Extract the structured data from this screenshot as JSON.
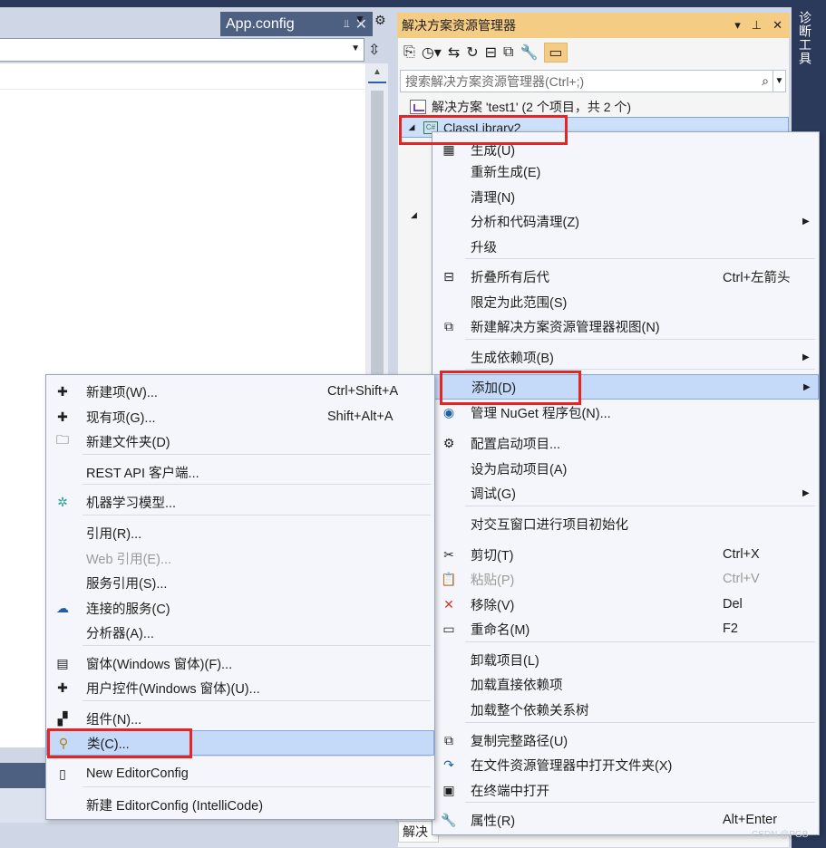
{
  "editor": {
    "tab_label": "App.config",
    "tab_pin_icon": "pin-icon",
    "tab_close_icon": "close-icon",
    "overflow_icon": "chevron-down-icon",
    "settings_icon": "gear-icon"
  },
  "diagnostics": {
    "label": "诊断工具"
  },
  "solution_explorer": {
    "title": "解决方案资源管理器",
    "title_buttons": [
      "▾",
      "⊥",
      "✕"
    ],
    "search_placeholder": "搜索解决方案资源管理器(Ctrl+;)",
    "solution_label": "解决方案 'test1' (2 个项目，共 2 个)",
    "project_label": "ClassLibrary2",
    "bottom_tab": "解决"
  },
  "context_menu": {
    "items": [
      {
        "label": "生成(U)",
        "icon": "build-icon",
        "shortcut": "",
        "submenu": false
      },
      {
        "label": "重新生成(E)",
        "icon": "",
        "shortcut": "",
        "submenu": false
      },
      {
        "label": "清理(N)",
        "icon": "",
        "shortcut": "",
        "submenu": false
      },
      {
        "label": "分析和代码清理(Z)",
        "icon": "",
        "shortcut": "",
        "submenu": true
      },
      {
        "label": "升级",
        "icon": "",
        "shortcut": "",
        "submenu": false
      },
      {
        "label": "折叠所有后代",
        "icon": "collapse-icon",
        "shortcut": "Ctrl+左箭头",
        "submenu": false
      },
      {
        "label": "限定为此范围(S)",
        "icon": "",
        "shortcut": "",
        "submenu": false
      },
      {
        "label": "新建解决方案资源管理器视图(N)",
        "icon": "new-view-icon",
        "shortcut": "",
        "submenu": false
      },
      {
        "label": "生成依赖项(B)",
        "icon": "",
        "shortcut": "",
        "submenu": true
      },
      {
        "label": "添加(D)",
        "icon": "",
        "shortcut": "",
        "submenu": true
      },
      {
        "label": "管理 NuGet 程序包(N)...",
        "icon": "nuget-icon",
        "shortcut": "",
        "submenu": false
      },
      {
        "label": "配置启动项目...",
        "icon": "gear-icon",
        "shortcut": "",
        "submenu": false
      },
      {
        "label": "设为启动项目(A)",
        "icon": "",
        "shortcut": "",
        "submenu": false
      },
      {
        "label": "调试(G)",
        "icon": "",
        "shortcut": "",
        "submenu": true
      },
      {
        "label": "对交互窗口进行项目初始化",
        "icon": "",
        "shortcut": "",
        "submenu": false
      },
      {
        "label": "剪切(T)",
        "icon": "scissors-icon",
        "shortcut": "Ctrl+X",
        "submenu": false
      },
      {
        "label": "粘贴(P)",
        "icon": "paste-icon",
        "shortcut": "Ctrl+V",
        "submenu": false
      },
      {
        "label": "移除(V)",
        "icon": "remove-icon",
        "shortcut": "Del",
        "submenu": false
      },
      {
        "label": "重命名(M)",
        "icon": "rename-icon",
        "shortcut": "F2",
        "submenu": false
      },
      {
        "label": "卸载项目(L)",
        "icon": "",
        "shortcut": "",
        "submenu": false
      },
      {
        "label": "加载直接依赖项",
        "icon": "",
        "shortcut": "",
        "submenu": false
      },
      {
        "label": "加载整个依赖关系树",
        "icon": "",
        "shortcut": "",
        "submenu": false
      },
      {
        "label": "复制完整路径(U)",
        "icon": "copy-icon",
        "shortcut": "",
        "submenu": false
      },
      {
        "label": "在文件资源管理器中打开文件夹(X)",
        "icon": "open-folder-icon",
        "shortcut": "",
        "submenu": false
      },
      {
        "label": "在终端中打开",
        "icon": "terminal-icon",
        "shortcut": "",
        "submenu": false
      },
      {
        "label": "属性(R)",
        "icon": "wrench-icon",
        "shortcut": "Alt+Enter",
        "submenu": false
      }
    ]
  },
  "add_submenu": {
    "items": [
      {
        "label": "新建项(W)...",
        "icon": "new-item-icon",
        "shortcut": "Ctrl+Shift+A"
      },
      {
        "label": "现有项(G)...",
        "icon": "existing-item-icon",
        "shortcut": "Shift+Alt+A"
      },
      {
        "label": "新建文件夹(D)",
        "icon": "new-folder-icon",
        "shortcut": ""
      },
      {
        "label": "REST API 客户端...",
        "icon": "",
        "shortcut": ""
      },
      {
        "label": "机器学习模型...",
        "icon": "ml-model-icon",
        "shortcut": ""
      },
      {
        "label": "引用(R)...",
        "icon": "",
        "shortcut": ""
      },
      {
        "label": "Web 引用(E)...",
        "icon": "",
        "shortcut": ""
      },
      {
        "label": "服务引用(S)...",
        "icon": "",
        "shortcut": ""
      },
      {
        "label": "连接的服务(C)",
        "icon": "connected-service-icon",
        "shortcut": ""
      },
      {
        "label": "分析器(A)...",
        "icon": "",
        "shortcut": ""
      },
      {
        "label": "窗体(Windows 窗体)(F)...",
        "icon": "form-icon",
        "shortcut": ""
      },
      {
        "label": "用户控件(Windows 窗体)(U)...",
        "icon": "user-control-icon",
        "shortcut": ""
      },
      {
        "label": "组件(N)...",
        "icon": "component-icon",
        "shortcut": ""
      },
      {
        "label": "类(C)...",
        "icon": "class-icon",
        "shortcut": ""
      },
      {
        "label": "New EditorConfig",
        "icon": "editorconfig-icon",
        "shortcut": ""
      },
      {
        "label": "新建 EditorConfig (IntelliCode)",
        "icon": "",
        "shortcut": ""
      }
    ]
  },
  "watermark": "CSDN @PGB"
}
